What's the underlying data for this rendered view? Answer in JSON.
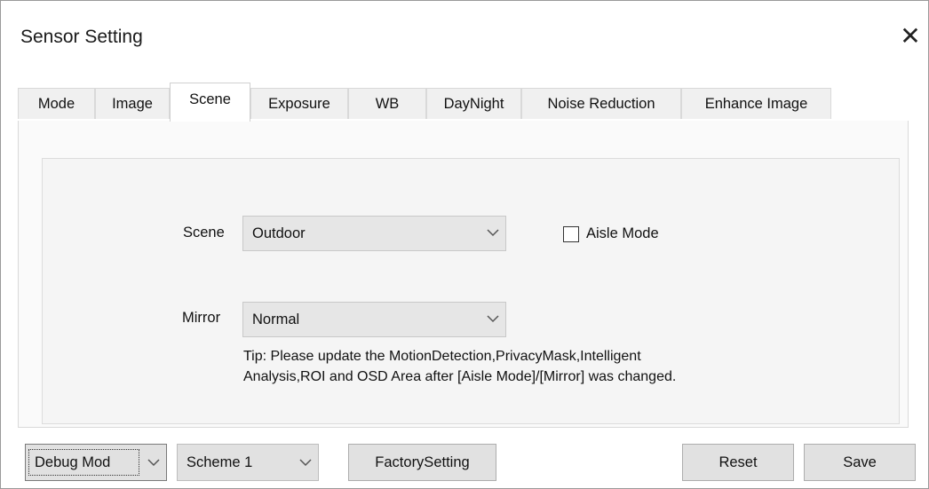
{
  "window": {
    "title": "Sensor Setting",
    "close_glyph": "✕",
    "close_icon": "close-icon"
  },
  "tabs": [
    {
      "label": "Mode"
    },
    {
      "label": "Image"
    },
    {
      "label": "Scene"
    },
    {
      "label": "Exposure"
    },
    {
      "label": "WB"
    },
    {
      "label": "DayNight"
    },
    {
      "label": "Noise Reduction"
    },
    {
      "label": "Enhance Image"
    }
  ],
  "active_tab": "Scene",
  "scene": {
    "scene_label": "Scene",
    "scene_value": "Outdoor",
    "aisle_mode_label": "Aisle Mode",
    "aisle_mode_checked": false,
    "mirror_label": "Mirror",
    "mirror_value": "Normal",
    "tip_line1": "Tip: Please update the MotionDetection,PrivacyMask,Intelligent",
    "tip_line2": "Analysis,ROI and OSD Area after [Aisle Mode]/[Mirror] was changed."
  },
  "bottom": {
    "mode_value": "Debug Mod",
    "scheme_value": "Scheme 1",
    "factory_label": "FactorySetting",
    "reset_label": "Reset",
    "save_label": "Save"
  },
  "colors": {
    "window_bg": "#ffffff",
    "control_bg": "#e1e1e1",
    "border": "#adadad"
  }
}
